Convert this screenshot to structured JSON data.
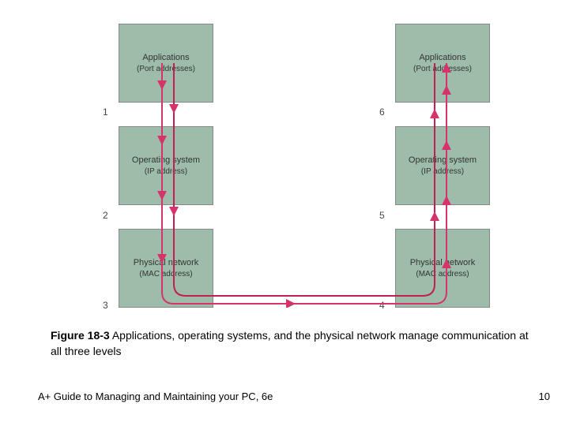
{
  "diagram": {
    "left": {
      "top": {
        "line1": "Applications",
        "line2": "(Port addresses)"
      },
      "middle": {
        "line1": "Operating system",
        "line2": "(IP address)"
      },
      "bottom": {
        "line1": "Physical network",
        "line2": "(MAC address)"
      }
    },
    "right": {
      "top": {
        "line1": "Applications",
        "line2": "(Port addresses)"
      },
      "middle": {
        "line1": "Operating system",
        "line2": "(IP address)"
      },
      "bottom": {
        "line1": "Physical network",
        "line2": "(MAC address)"
      }
    },
    "numbers": {
      "n1": "1",
      "n2": "2",
      "n3": "3",
      "n4": "4",
      "n5": "5",
      "n6": "6"
    }
  },
  "caption": {
    "fignum": "Figure 18-3",
    "rest": " Applications, operating systems, and the physical network manage communication at all three levels"
  },
  "footer": {
    "book": "A+ Guide to Managing and Maintaining your PC, 6e",
    "page": "10"
  }
}
